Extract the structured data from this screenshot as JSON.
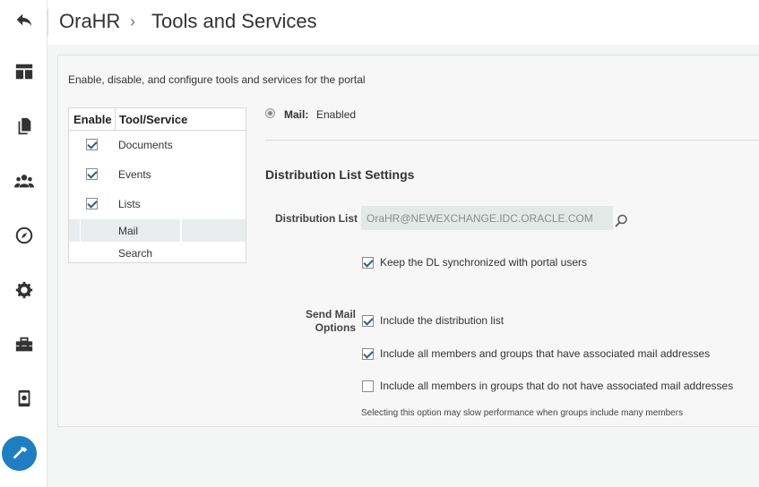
{
  "header": {
    "app_name": "OraHR",
    "separator": "›",
    "page_title": "Tools and Services"
  },
  "rail": {
    "items": [
      "back-icon",
      "layout-icon",
      "pages-icon",
      "people-icon",
      "compass-icon",
      "gear-icon",
      "toolbox-icon",
      "device-icon",
      "hammer-icon"
    ],
    "active": "hammer-icon",
    "accent": "#1f7ec2"
  },
  "intro": "Enable, disable, and configure tools and services for the portal",
  "tools_table": {
    "col_enable": "Enable",
    "col_tool": "Tool/Service",
    "rows": [
      {
        "name": "Documents",
        "checked": true
      },
      {
        "name": "Events",
        "checked": true
      },
      {
        "name": "Lists",
        "checked": true
      },
      {
        "name": "Mail",
        "checked": null
      },
      {
        "name": "Search",
        "checked": null
      }
    ]
  },
  "mail": {
    "label": "Mail:",
    "status": "Enabled"
  },
  "settings": {
    "title": "Distribution List Settings",
    "dl_label": "Distribution List",
    "dl_value": "OraHR@NEWEXCHANGE.IDC.ORACLE.COM",
    "keep_sync": "Keep the DL synchronized with portal users",
    "send_mail_label": "Send Mail Options",
    "options": [
      {
        "label": "Include the distribution list",
        "checked": true
      },
      {
        "label": "Include all members and groups that have associated mail addresses",
        "checked": true
      },
      {
        "label": "Include all members in groups that do not have associated mail addresses",
        "checked": false
      }
    ],
    "note": "Selecting this option may slow performance when groups include many members"
  }
}
